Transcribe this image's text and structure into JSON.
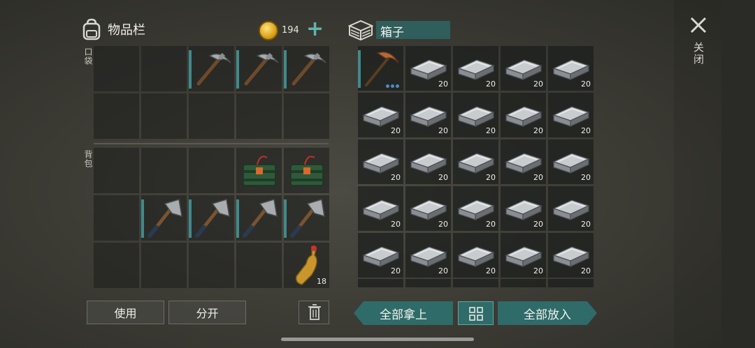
{
  "inventory": {
    "title": "物品栏",
    "coins": "194",
    "pocket_label": "口袋",
    "backpack_label": "背包",
    "pocket_slots": [
      {
        "item": ""
      },
      {
        "item": ""
      },
      {
        "item": "pickaxe",
        "bar": true
      },
      {
        "item": "pickaxe",
        "bar": true
      },
      {
        "item": "pickaxe",
        "bar": true
      },
      {
        "item": ""
      },
      {
        "item": ""
      },
      {
        "item": ""
      },
      {
        "item": ""
      },
      {
        "item": ""
      }
    ],
    "backpack_slots": [
      {
        "item": ""
      },
      {
        "item": ""
      },
      {
        "item": ""
      },
      {
        "item": "explosive"
      },
      {
        "item": "explosive"
      },
      {
        "item": ""
      },
      {
        "item": "hatchet",
        "bar": true
      },
      {
        "item": "hatchet",
        "bar": true
      },
      {
        "item": "hatchet",
        "bar": true
      },
      {
        "item": "hatchet",
        "bar": true
      },
      {
        "item": ""
      },
      {
        "item": ""
      },
      {
        "item": ""
      },
      {
        "item": ""
      },
      {
        "item": "bottle",
        "count": "18"
      }
    ]
  },
  "box": {
    "title": "箱子",
    "slots": [
      {
        "item": "copper-pickaxe",
        "bar": true,
        "dots": true
      },
      {
        "item": "iron-bar",
        "count": "20"
      },
      {
        "item": "iron-bar",
        "count": "20"
      },
      {
        "item": "iron-bar",
        "count": "20"
      },
      {
        "item": "iron-bar",
        "count": "20"
      },
      {
        "item": "iron-bar",
        "count": "20"
      },
      {
        "item": "iron-bar",
        "count": "20"
      },
      {
        "item": "iron-bar",
        "count": "20"
      },
      {
        "item": "iron-bar",
        "count": "20"
      },
      {
        "item": "iron-bar",
        "count": "20"
      },
      {
        "item": "iron-bar",
        "count": "20"
      },
      {
        "item": "iron-bar",
        "count": "20"
      },
      {
        "item": "iron-bar",
        "count": "20"
      },
      {
        "item": "iron-bar",
        "count": "20"
      },
      {
        "item": "iron-bar",
        "count": "20"
      },
      {
        "item": "iron-bar",
        "count": "20"
      },
      {
        "item": "iron-bar",
        "count": "20"
      },
      {
        "item": "iron-bar",
        "count": "20"
      },
      {
        "item": "iron-bar",
        "count": "20"
      },
      {
        "item": "iron-bar",
        "count": "20"
      },
      {
        "item": "iron-bar",
        "count": "20"
      },
      {
        "item": "iron-bar",
        "count": "20"
      },
      {
        "item": "iron-bar",
        "count": "20"
      },
      {
        "item": "iron-bar",
        "count": "20"
      },
      {
        "item": "iron-bar",
        "count": "20"
      }
    ]
  },
  "buttons": {
    "use": "使用",
    "split": "分开",
    "take_all": "全部拿上",
    "put_all": "全部放入",
    "close": "关闭"
  },
  "colors": {
    "accent": "#2e6b69",
    "durability_bar": "#3f8a8c"
  }
}
